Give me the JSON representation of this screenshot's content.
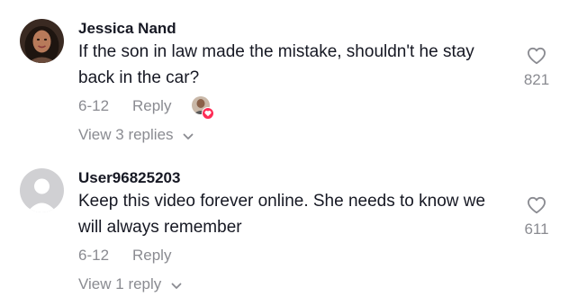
{
  "comments": [
    {
      "username": "Jessica Nand",
      "text": "If the son in law made the mistake, shouldn't he stay back in the car?",
      "date": "6-12",
      "reply_label": "Reply",
      "likes": "821",
      "view_replies": "View 3 replies",
      "liked_by_creator": true,
      "heart_icon": "heart-outline-icon"
    },
    {
      "username": "User96825203",
      "text": "Keep this video forever online. She needs to know we will always remember",
      "date": "6-12",
      "reply_label": "Reply",
      "likes": "611",
      "view_replies": "View 1 reply",
      "liked_by_creator": false,
      "heart_icon": "heart-outline-icon"
    }
  ],
  "colors": {
    "text": "#161823",
    "secondary": "#8a8b91",
    "heart_badge": "#fe2c55",
    "default_avatar": "#d0d0d3"
  }
}
